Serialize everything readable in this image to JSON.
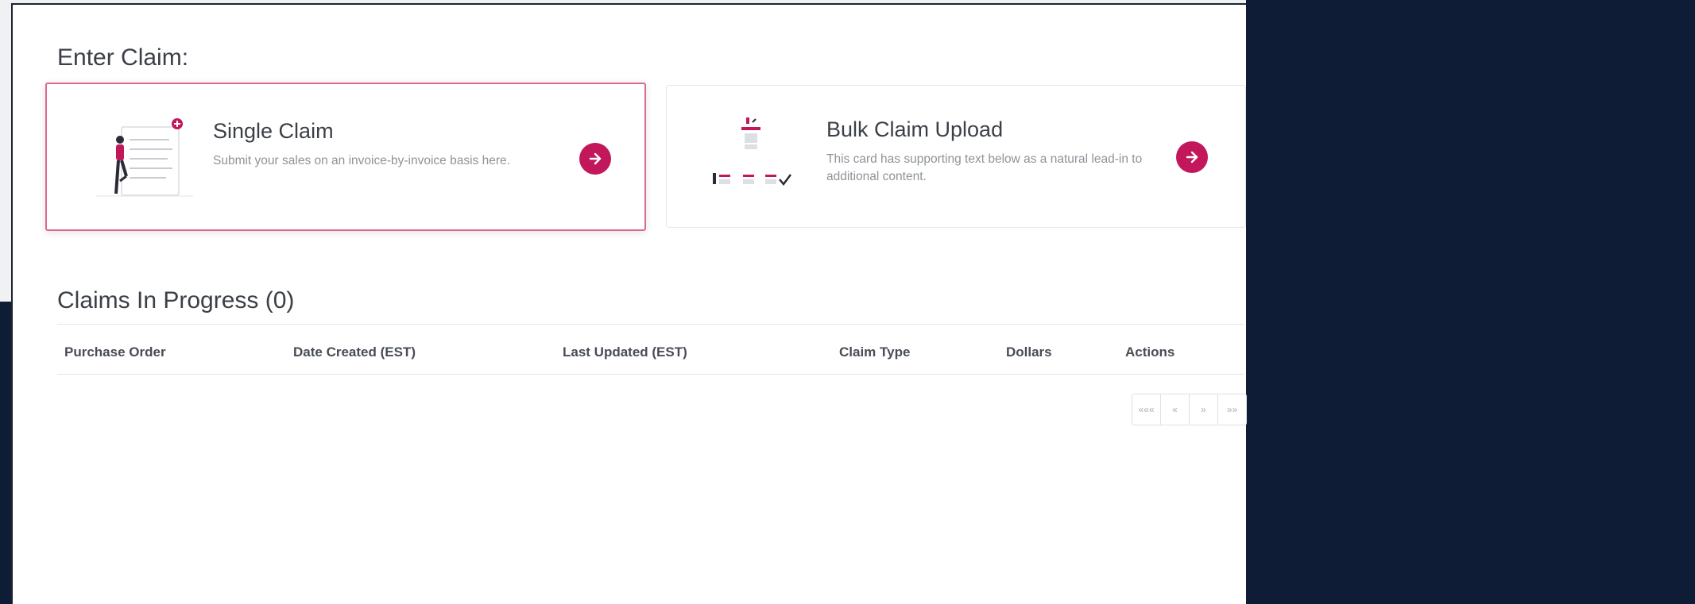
{
  "enter_claim": {
    "heading": "Enter Claim:",
    "cards": [
      {
        "title": "Single Claim",
        "description": "Submit your sales on an invoice-by-invoice basis here.",
        "icon": "arrow-right-icon"
      },
      {
        "title": "Bulk Claim Upload",
        "description": "This card has supporting text below as a natural lead-in to additional content.",
        "icon": "arrow-right-icon"
      }
    ]
  },
  "claims_in_progress": {
    "heading": "Claims In Progress (0)",
    "columns": [
      "Purchase Order",
      "Date Created (EST)",
      "Last Updated (EST)",
      "Claim Type",
      "Dollars",
      "Actions"
    ],
    "rows": []
  },
  "pagination": {
    "first": "«««",
    "prev": "«",
    "next": "»",
    "last": "»»"
  },
  "colors": {
    "accent": "#c2185b",
    "selected_border": "#d96a8e",
    "frame_dark": "#0e1c36"
  }
}
